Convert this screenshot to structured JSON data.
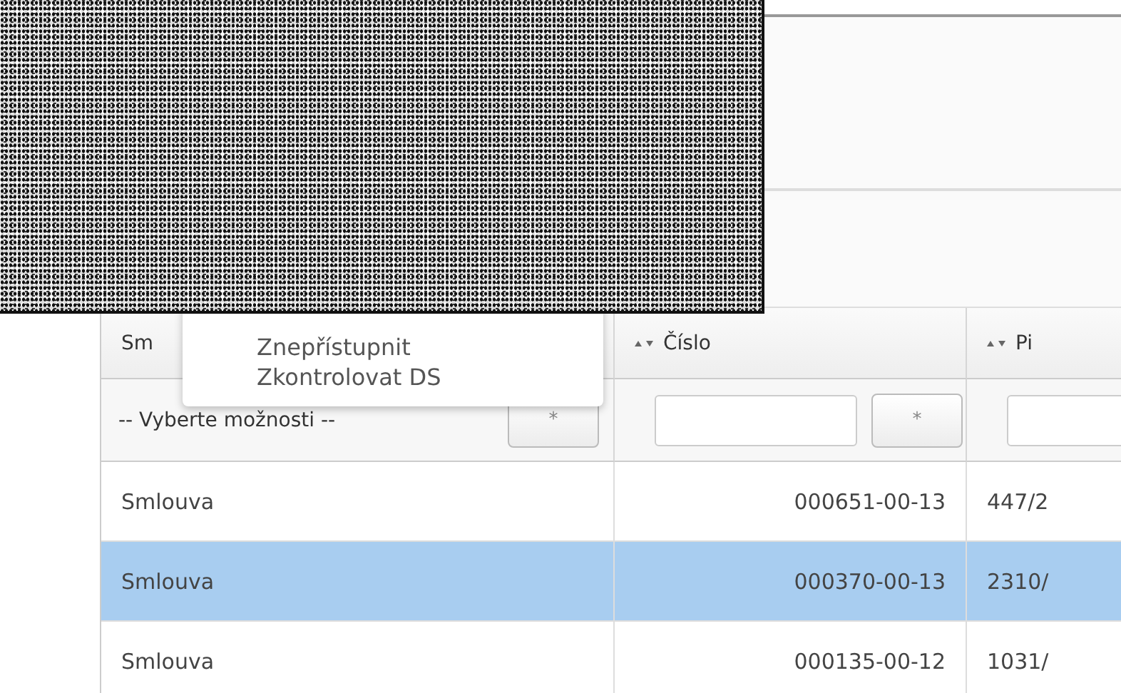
{
  "menu": {
    "items": [
      {
        "label": "Znepřístupnit"
      },
      {
        "label": "Zkontrolovat DS"
      }
    ]
  },
  "table": {
    "columns": [
      {
        "label": "Sm",
        "sortable": false
      },
      {
        "label": "Číslo",
        "sortable": true
      },
      {
        "label": "Pi",
        "sortable": true
      }
    ],
    "filters": [
      {
        "kind": "select",
        "value": "-- Vyberte možnosti --",
        "button": "*"
      },
      {
        "kind": "input",
        "button": "*"
      },
      {
        "kind": "input"
      }
    ],
    "rows": [
      {
        "cells": [
          "Smlouva",
          "000651-00-13",
          "447/2"
        ],
        "selected": false
      },
      {
        "cells": [
          "Smlouva",
          "000370-00-13",
          "2310/"
        ],
        "selected": true
      },
      {
        "cells": [
          "Smlouva",
          "000135-00-12",
          "1031/"
        ],
        "selected": false
      }
    ]
  }
}
